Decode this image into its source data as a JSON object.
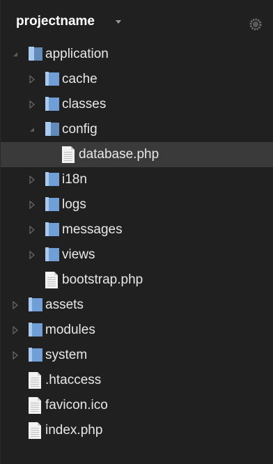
{
  "panel": {
    "project_name": "projectname"
  },
  "tree": [
    {
      "label": "application",
      "type": "folder",
      "expanded": true
    },
    {
      "label": "cache",
      "type": "folder",
      "expanded": false
    },
    {
      "label": "classes",
      "type": "folder",
      "expanded": false
    },
    {
      "label": "config",
      "type": "folder",
      "expanded": true
    },
    {
      "label": "database.php",
      "type": "file",
      "selected": true
    },
    {
      "label": "i18n",
      "type": "folder",
      "expanded": false
    },
    {
      "label": "logs",
      "type": "folder",
      "expanded": false
    },
    {
      "label": "messages",
      "type": "folder",
      "expanded": false
    },
    {
      "label": "views",
      "type": "folder",
      "expanded": false
    },
    {
      "label": "bootstrap.php",
      "type": "file"
    },
    {
      "label": "assets",
      "type": "folder",
      "expanded": false
    },
    {
      "label": "modules",
      "type": "folder",
      "expanded": false
    },
    {
      "label": "system",
      "type": "folder",
      "expanded": false
    },
    {
      "label": ".htaccess",
      "type": "file"
    },
    {
      "label": "favicon.ico",
      "type": "file"
    },
    {
      "label": "index.php",
      "type": "file"
    }
  ],
  "colors": {
    "background": "#202020",
    "selected_row": "#3a3a3a",
    "folder": "#6f9fd6",
    "text": "#e8e8e8"
  }
}
